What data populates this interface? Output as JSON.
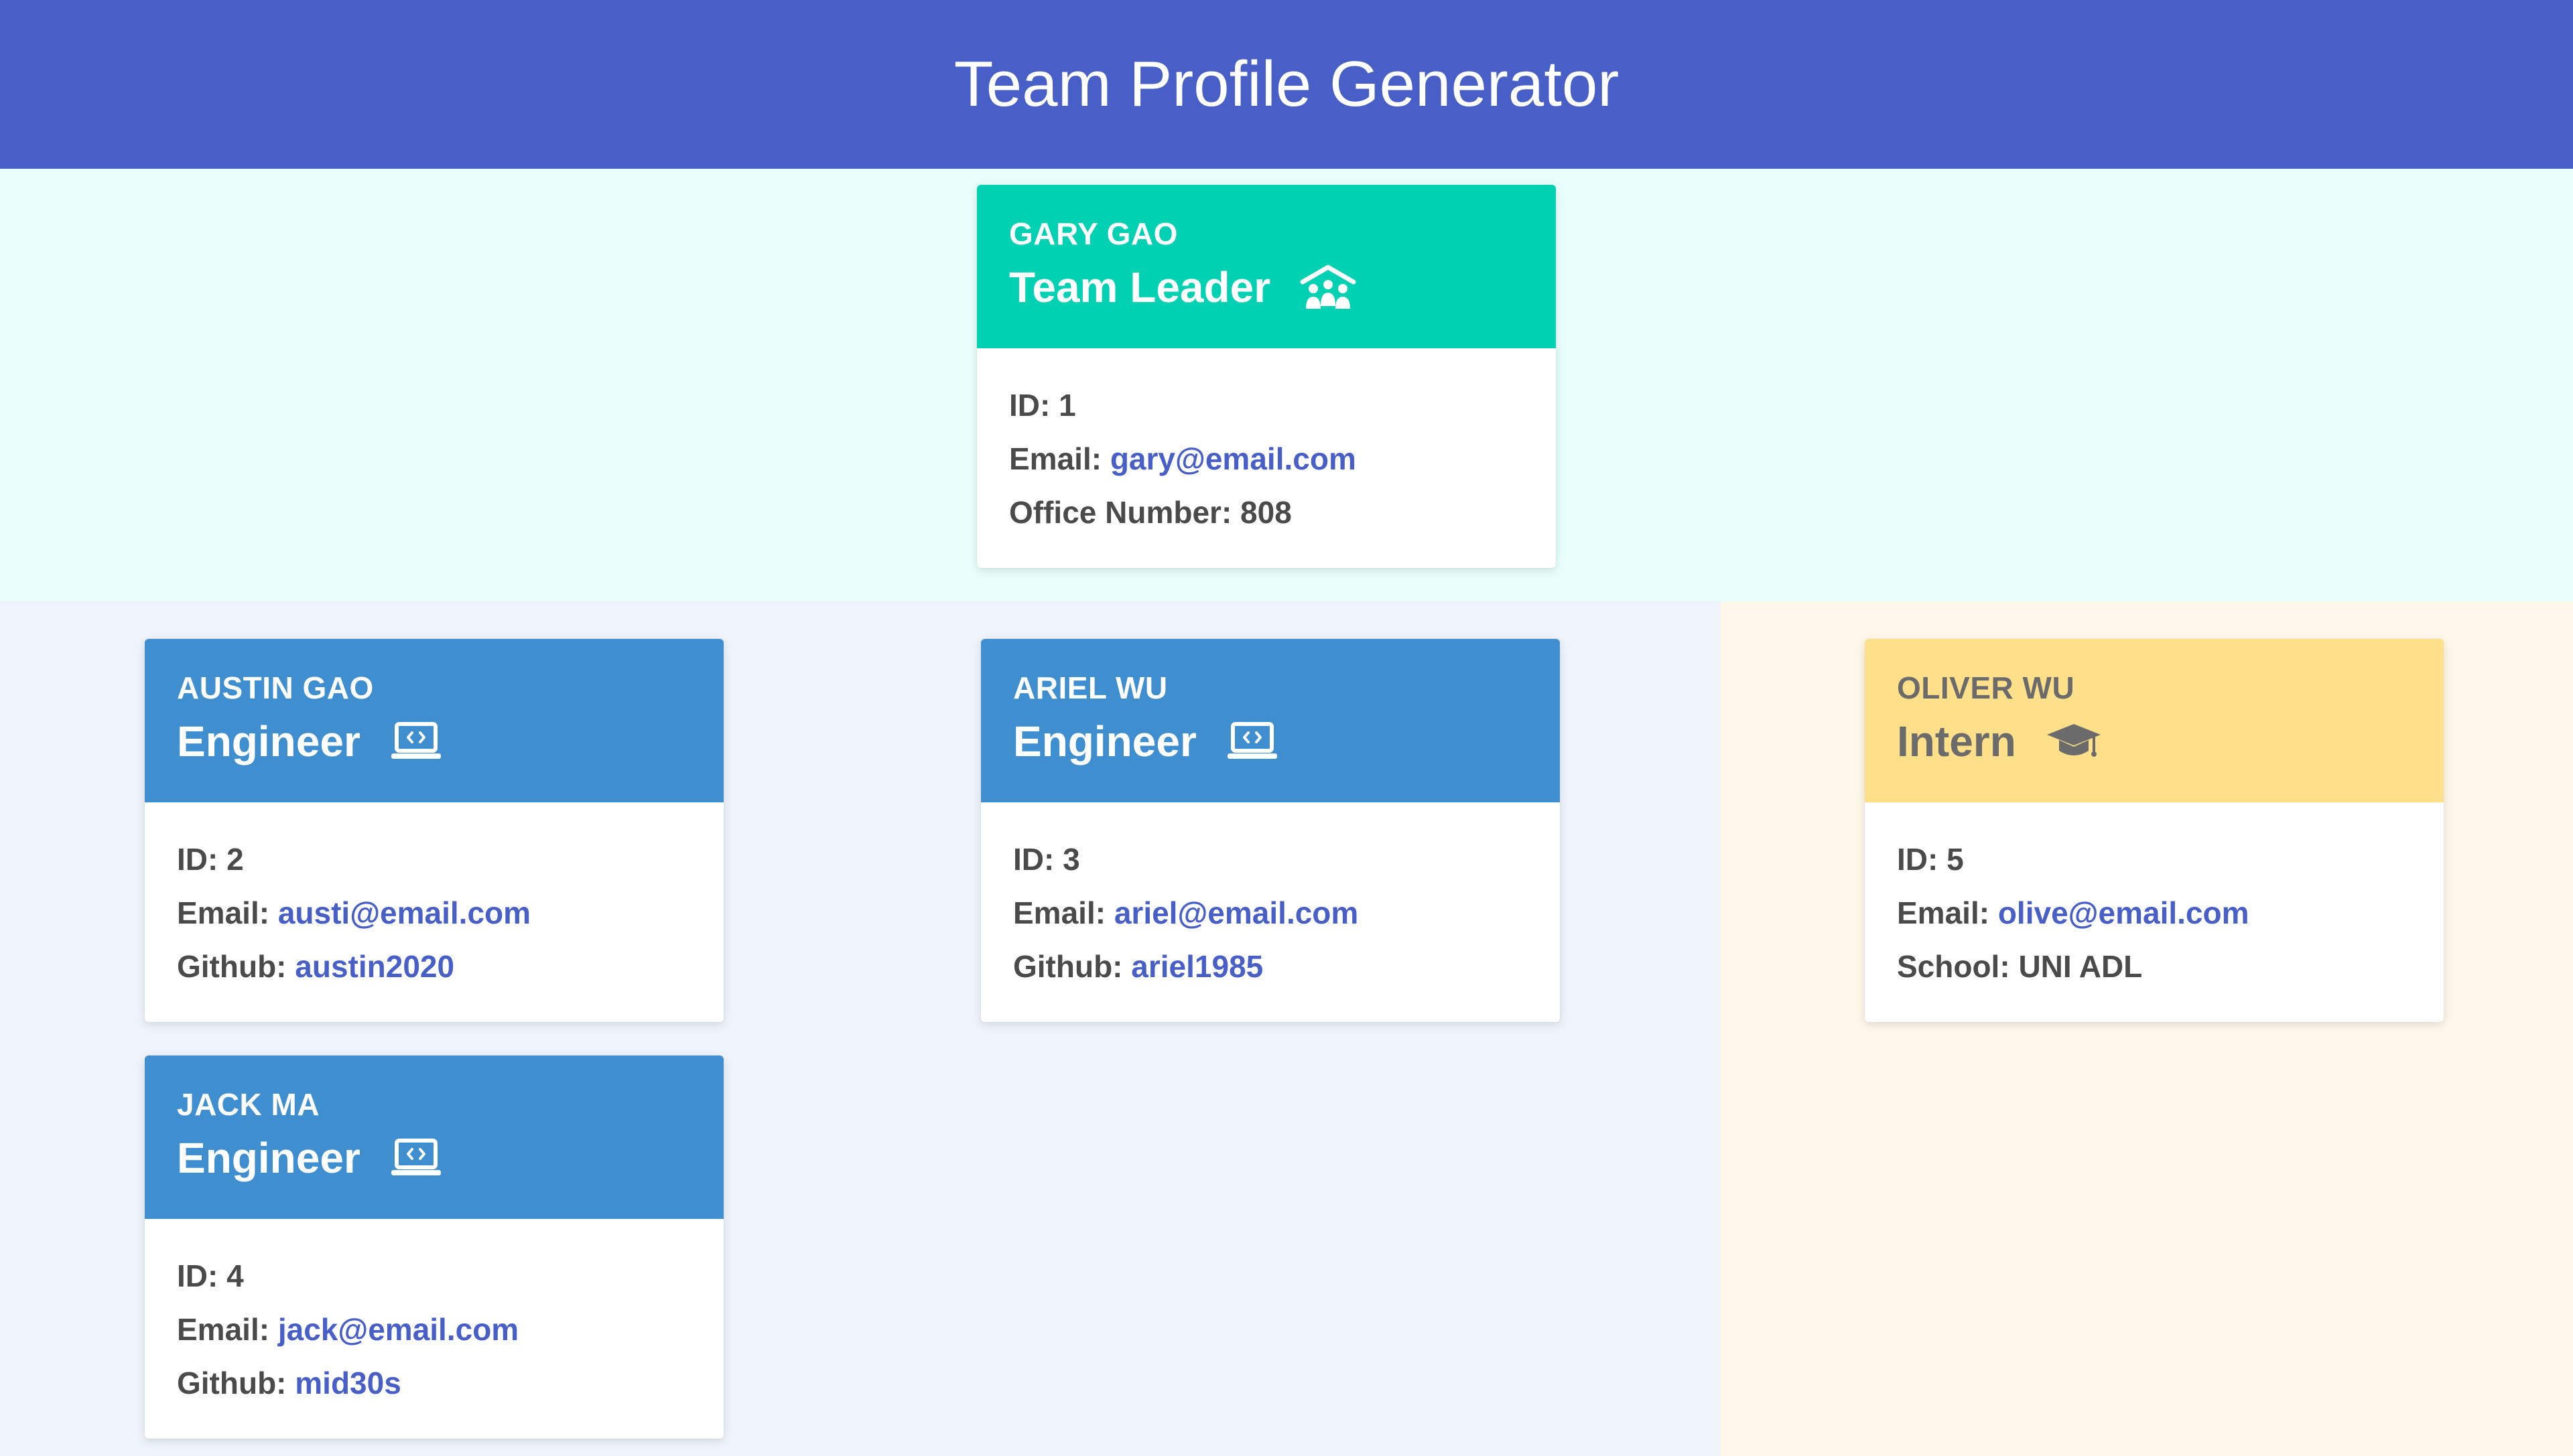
{
  "header": {
    "title": "Team Profile Generator"
  },
  "colors": {
    "header_bg": "#485fc7",
    "manager_head": "#00d1b2",
    "engineer_head": "#3e8ed0",
    "intern_head": "#ffe08a",
    "link": "#485fc7",
    "band_manager": "#e9fffc",
    "band_engineers": "#eff4fb",
    "band_interns": "#fef8ea"
  },
  "manager": {
    "name": "GARY GAO",
    "role": "Team Leader",
    "icon": "people-roof-icon",
    "id_label": "ID:",
    "id": "1",
    "email_label": "Email:",
    "email": "gary@email.com",
    "extra_label": "Office Number:",
    "extra": "808"
  },
  "engineers": [
    {
      "name": "AUSTIN GAO",
      "role": "Engineer",
      "icon": "laptop-code-icon",
      "id_label": "ID:",
      "id": "2",
      "email_label": "Email:",
      "email": "austi@email.com",
      "github_label": "Github:",
      "github": "austin2020"
    },
    {
      "name": "ARIEL WU",
      "role": "Engineer",
      "icon": "laptop-code-icon",
      "id_label": "ID:",
      "id": "3",
      "email_label": "Email:",
      "email": "ariel@email.com",
      "github_label": "Github:",
      "github": "ariel1985"
    },
    {
      "name": "JACK MA",
      "role": "Engineer",
      "icon": "laptop-code-icon",
      "id_label": "ID:",
      "id": "4",
      "email_label": "Email:",
      "email": "jack@email.com",
      "github_label": "Github:",
      "github": "mid30s"
    }
  ],
  "interns": [
    {
      "name": "OLIVER WU",
      "role": "Intern",
      "icon": "graduation-cap-icon",
      "id_label": "ID:",
      "id": "5",
      "email_label": "Email:",
      "email": "olive@email.com",
      "school_label": "School:",
      "school": "UNI ADL"
    }
  ]
}
